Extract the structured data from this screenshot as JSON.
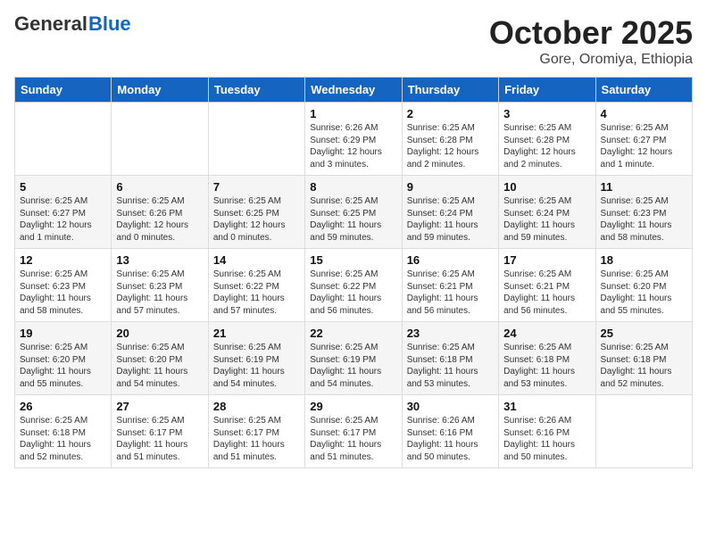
{
  "header": {
    "logo_general": "General",
    "logo_blue": "Blue",
    "month": "October 2025",
    "location": "Gore, Oromiya, Ethiopia"
  },
  "days_of_week": [
    "Sunday",
    "Monday",
    "Tuesday",
    "Wednesday",
    "Thursday",
    "Friday",
    "Saturday"
  ],
  "weeks": [
    [
      {
        "day": "",
        "content": ""
      },
      {
        "day": "",
        "content": ""
      },
      {
        "day": "",
        "content": ""
      },
      {
        "day": "1",
        "content": "Sunrise: 6:26 AM\nSunset: 6:29 PM\nDaylight: 12 hours and 3 minutes."
      },
      {
        "day": "2",
        "content": "Sunrise: 6:25 AM\nSunset: 6:28 PM\nDaylight: 12 hours and 2 minutes."
      },
      {
        "day": "3",
        "content": "Sunrise: 6:25 AM\nSunset: 6:28 PM\nDaylight: 12 hours and 2 minutes."
      },
      {
        "day": "4",
        "content": "Sunrise: 6:25 AM\nSunset: 6:27 PM\nDaylight: 12 hours and 1 minute."
      }
    ],
    [
      {
        "day": "5",
        "content": "Sunrise: 6:25 AM\nSunset: 6:27 PM\nDaylight: 12 hours and 1 minute."
      },
      {
        "day": "6",
        "content": "Sunrise: 6:25 AM\nSunset: 6:26 PM\nDaylight: 12 hours and 0 minutes."
      },
      {
        "day": "7",
        "content": "Sunrise: 6:25 AM\nSunset: 6:25 PM\nDaylight: 12 hours and 0 minutes."
      },
      {
        "day": "8",
        "content": "Sunrise: 6:25 AM\nSunset: 6:25 PM\nDaylight: 11 hours and 59 minutes."
      },
      {
        "day": "9",
        "content": "Sunrise: 6:25 AM\nSunset: 6:24 PM\nDaylight: 11 hours and 59 minutes."
      },
      {
        "day": "10",
        "content": "Sunrise: 6:25 AM\nSunset: 6:24 PM\nDaylight: 11 hours and 59 minutes."
      },
      {
        "day": "11",
        "content": "Sunrise: 6:25 AM\nSunset: 6:23 PM\nDaylight: 11 hours and 58 minutes."
      }
    ],
    [
      {
        "day": "12",
        "content": "Sunrise: 6:25 AM\nSunset: 6:23 PM\nDaylight: 11 hours and 58 minutes."
      },
      {
        "day": "13",
        "content": "Sunrise: 6:25 AM\nSunset: 6:23 PM\nDaylight: 11 hours and 57 minutes."
      },
      {
        "day": "14",
        "content": "Sunrise: 6:25 AM\nSunset: 6:22 PM\nDaylight: 11 hours and 57 minutes."
      },
      {
        "day": "15",
        "content": "Sunrise: 6:25 AM\nSunset: 6:22 PM\nDaylight: 11 hours and 56 minutes."
      },
      {
        "day": "16",
        "content": "Sunrise: 6:25 AM\nSunset: 6:21 PM\nDaylight: 11 hours and 56 minutes."
      },
      {
        "day": "17",
        "content": "Sunrise: 6:25 AM\nSunset: 6:21 PM\nDaylight: 11 hours and 56 minutes."
      },
      {
        "day": "18",
        "content": "Sunrise: 6:25 AM\nSunset: 6:20 PM\nDaylight: 11 hours and 55 minutes."
      }
    ],
    [
      {
        "day": "19",
        "content": "Sunrise: 6:25 AM\nSunset: 6:20 PM\nDaylight: 11 hours and 55 minutes."
      },
      {
        "day": "20",
        "content": "Sunrise: 6:25 AM\nSunset: 6:20 PM\nDaylight: 11 hours and 54 minutes."
      },
      {
        "day": "21",
        "content": "Sunrise: 6:25 AM\nSunset: 6:19 PM\nDaylight: 11 hours and 54 minutes."
      },
      {
        "day": "22",
        "content": "Sunrise: 6:25 AM\nSunset: 6:19 PM\nDaylight: 11 hours and 54 minutes."
      },
      {
        "day": "23",
        "content": "Sunrise: 6:25 AM\nSunset: 6:18 PM\nDaylight: 11 hours and 53 minutes."
      },
      {
        "day": "24",
        "content": "Sunrise: 6:25 AM\nSunset: 6:18 PM\nDaylight: 11 hours and 53 minutes."
      },
      {
        "day": "25",
        "content": "Sunrise: 6:25 AM\nSunset: 6:18 PM\nDaylight: 11 hours and 52 minutes."
      }
    ],
    [
      {
        "day": "26",
        "content": "Sunrise: 6:25 AM\nSunset: 6:18 PM\nDaylight: 11 hours and 52 minutes."
      },
      {
        "day": "27",
        "content": "Sunrise: 6:25 AM\nSunset: 6:17 PM\nDaylight: 11 hours and 51 minutes."
      },
      {
        "day": "28",
        "content": "Sunrise: 6:25 AM\nSunset: 6:17 PM\nDaylight: 11 hours and 51 minutes."
      },
      {
        "day": "29",
        "content": "Sunrise: 6:25 AM\nSunset: 6:17 PM\nDaylight: 11 hours and 51 minutes."
      },
      {
        "day": "30",
        "content": "Sunrise: 6:26 AM\nSunset: 6:16 PM\nDaylight: 11 hours and 50 minutes."
      },
      {
        "day": "31",
        "content": "Sunrise: 6:26 AM\nSunset: 6:16 PM\nDaylight: 11 hours and 50 minutes."
      },
      {
        "day": "",
        "content": ""
      }
    ]
  ]
}
